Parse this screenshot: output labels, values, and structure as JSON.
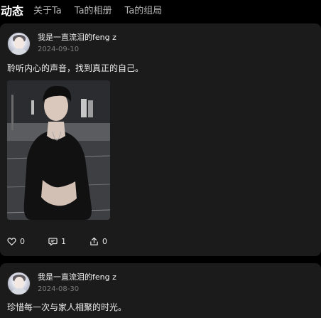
{
  "tabs": [
    {
      "label": "动态",
      "active": true
    },
    {
      "label": "关于Ta",
      "active": false
    },
    {
      "label": "Ta的相册",
      "active": false
    },
    {
      "label": "Ta的组局",
      "active": false
    }
  ],
  "posts": [
    {
      "username": "我是一直流泪的feng z",
      "date": "2024-09-10",
      "text": "聆听内心的声音，找到真正的自己。",
      "likes": "0",
      "comments": "1",
      "shares": "0"
    },
    {
      "username": "我是一直流泪的feng z",
      "date": "2024-08-30",
      "text": "珍惜每一次与家人相聚的时光。"
    }
  ],
  "icons": {
    "like": "heart-icon",
    "comment": "comment-icon",
    "share": "share-icon"
  },
  "colors": {
    "background": "#000000",
    "card": "#1b1b1b",
    "text_primary": "#efefef",
    "text_secondary": "#7d7d7d"
  }
}
